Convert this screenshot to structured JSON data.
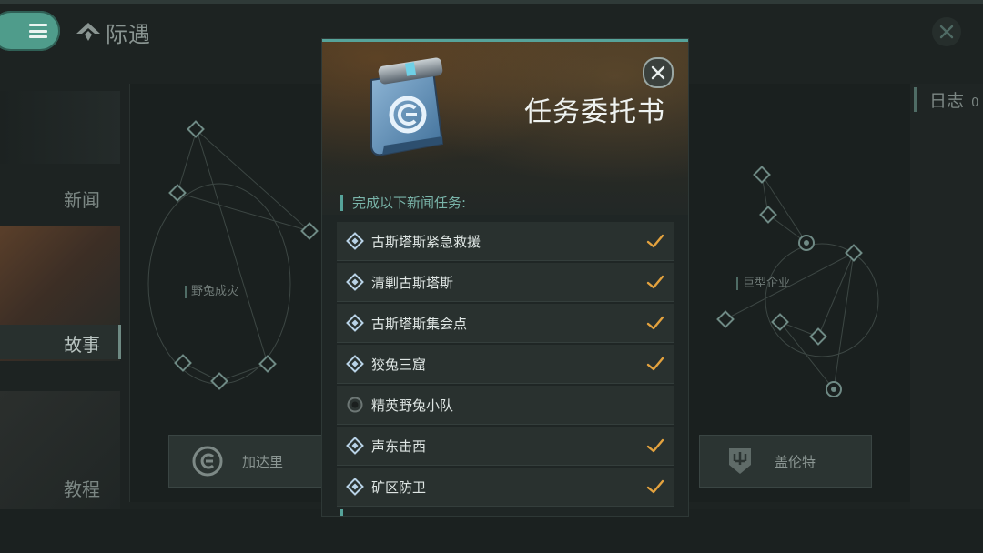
{
  "header": {
    "title": "际遇",
    "menu_icon": "hamburger-menu-icon",
    "close_icon": "close-icon"
  },
  "left_tabs": [
    {
      "label": "新闻"
    },
    {
      "label": "故事"
    },
    {
      "label": "教程"
    }
  ],
  "map": {
    "nodes_labels": [
      "野兔成灾",
      "巨型企业"
    ]
  },
  "right_panel": {
    "log_label": "日志",
    "log_count": "0"
  },
  "characters": [
    {
      "name": "加达里",
      "icon": "caldari-faction-icon"
    },
    {
      "name": "盖伦特",
      "icon": "gallente-faction-icon"
    }
  ],
  "modal": {
    "title": "任务委托书",
    "section_header": "完成以下新闻任务:",
    "tasks": [
      {
        "label": "古斯塔斯紧急救援",
        "completed": true,
        "icon": "diamond-icon"
      },
      {
        "label": "清剿古斯塔斯",
        "completed": true,
        "icon": "diamond-icon"
      },
      {
        "label": "古斯塔斯集会点",
        "completed": true,
        "icon": "diamond-icon"
      },
      {
        "label": "狡兔三窟",
        "completed": true,
        "icon": "diamond-icon"
      },
      {
        "label": "精英野兔小队",
        "completed": false,
        "icon": "circle-dot-icon"
      },
      {
        "label": "声东击西",
        "completed": true,
        "icon": "diamond-icon"
      },
      {
        "label": "矿区防卫",
        "completed": true,
        "icon": "diamond-icon"
      }
    ],
    "colors": {
      "accent": "#56a39a",
      "check": "#e3a23e",
      "row_bg": "#29312f"
    }
  }
}
